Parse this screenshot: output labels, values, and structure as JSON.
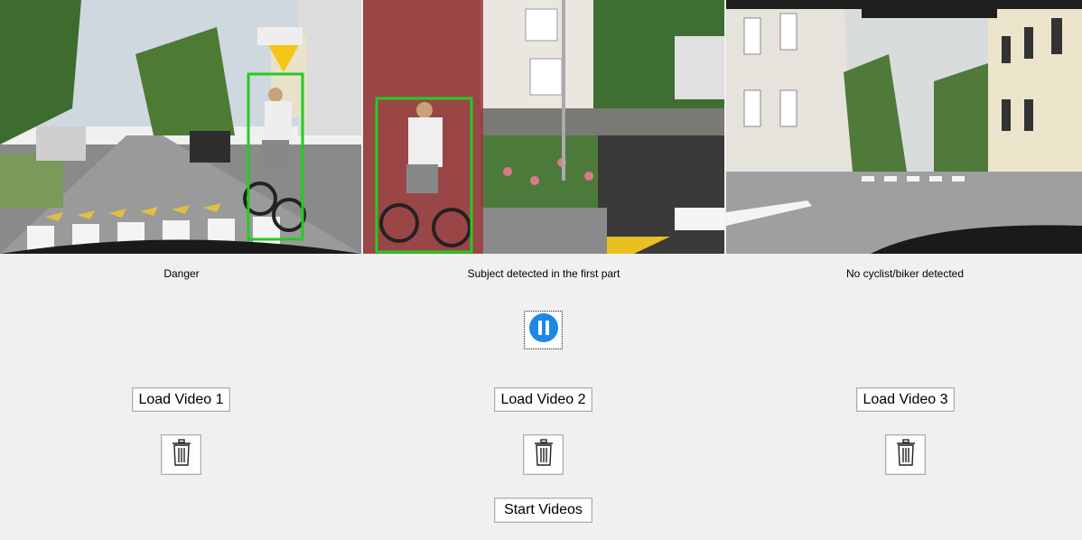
{
  "videos": [
    {
      "status": "Danger",
      "load_label": "Load Video 1"
    },
    {
      "status": "Subject detected in the first part",
      "load_label": "Load Video 2"
    },
    {
      "status": "No cyclist/biker detected",
      "load_label": "Load Video 3"
    }
  ],
  "controls": {
    "start_label": "Start Videos",
    "pause_icon": "pause-icon",
    "delete_icon": "trash-icon"
  },
  "colors": {
    "detection_box": "#22cc22",
    "danger_overlay": "#c0392b",
    "pause_accent": "#1e88e5"
  }
}
